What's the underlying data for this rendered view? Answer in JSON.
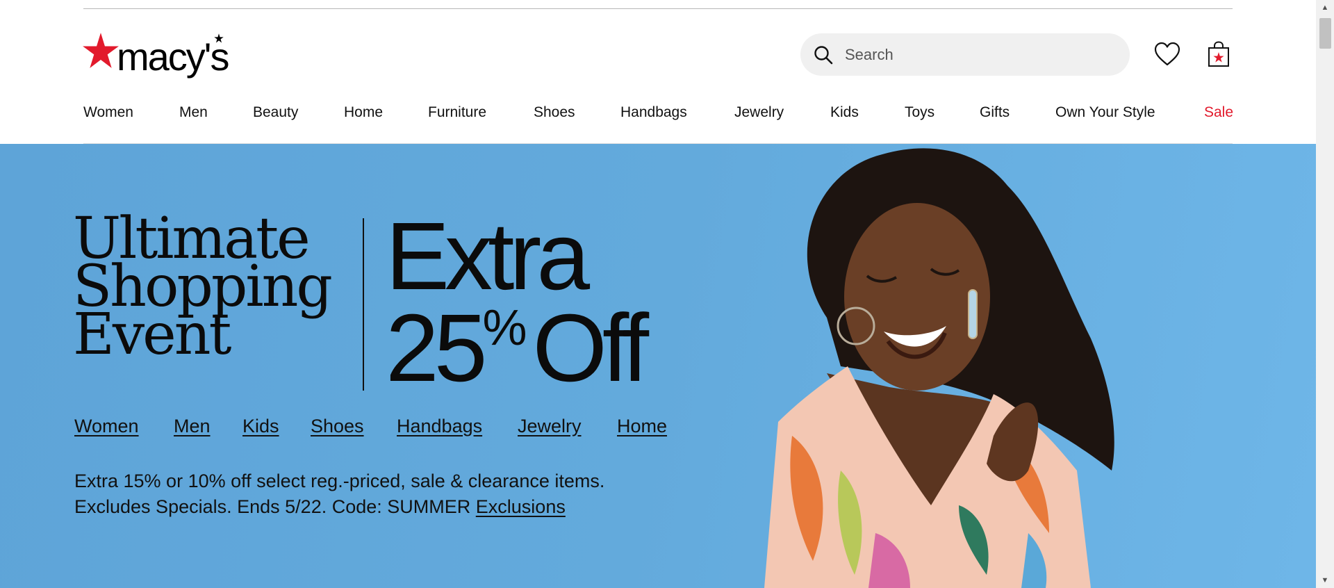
{
  "brand": {
    "logo_text": "macy's",
    "accent": "#e21a2c"
  },
  "header": {
    "search_placeholder": "Search",
    "icons": {
      "search": "search-icon",
      "wishlist": "heart-icon",
      "bag": "shopping-bag-icon"
    }
  },
  "nav": {
    "items": [
      "Women",
      "Men",
      "Beauty",
      "Home",
      "Furniture",
      "Shoes",
      "Handbags",
      "Jewelry",
      "Kids",
      "Toys",
      "Gifts",
      "Own Your Style",
      "Sale"
    ]
  },
  "hero": {
    "title_line1": "Ultimate",
    "title_line2": "Shopping",
    "title_line3": "Event",
    "offer_line1": "Extra",
    "offer_number": "25",
    "offer_percent": "%",
    "offer_off": "Off",
    "links": [
      "Women",
      "Men",
      "Kids",
      "Shoes",
      "Handbags",
      "Jewelry",
      "Home"
    ],
    "note_line1": "Extra 15% or 10% off select reg.-priced, sale & clearance items.",
    "note_line2": "Excludes Specials. Ends 5/22. Code: SUMMER",
    "exclusions_link": "Exclusions",
    "background": "#63aadc"
  }
}
